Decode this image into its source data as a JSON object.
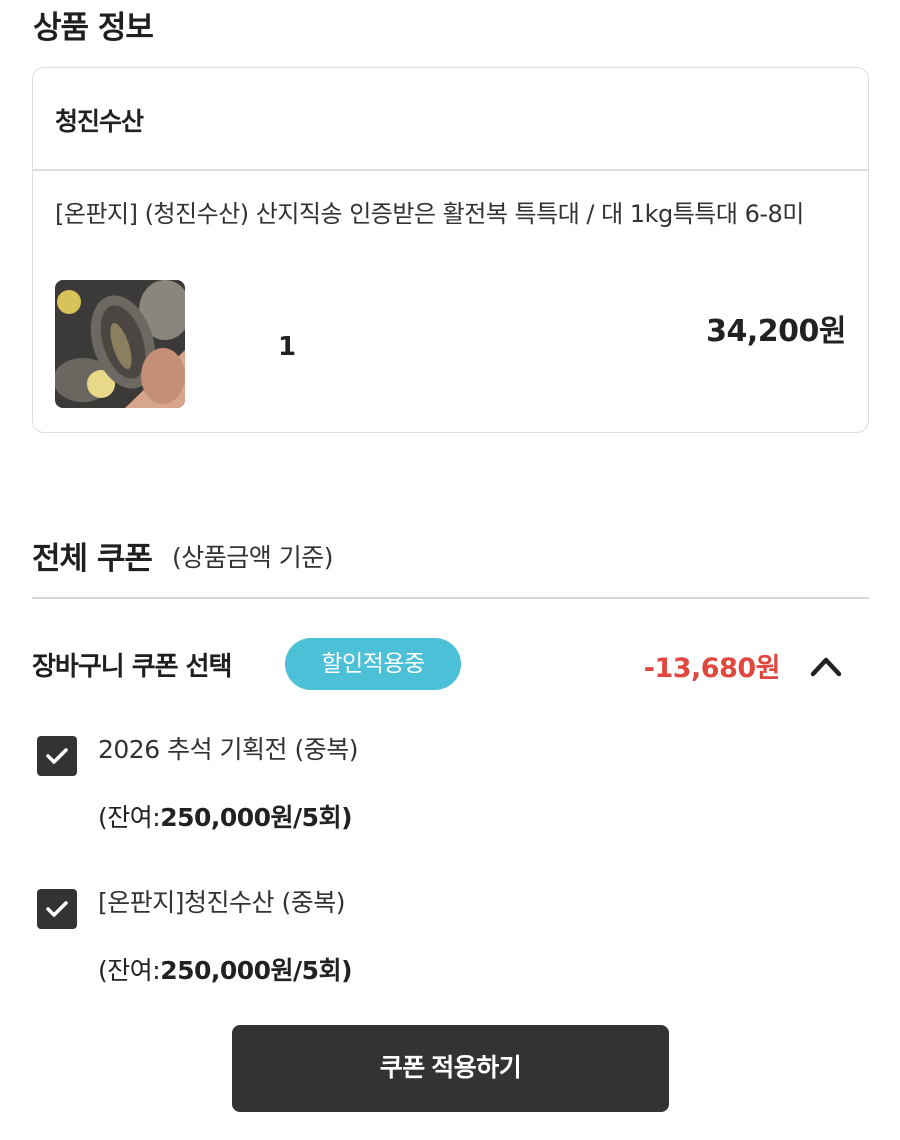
{
  "product_info": {
    "section_title": "상품 정보",
    "seller": "청진수산",
    "product_name": "[온판지] (청진수산) 산지직송 인증받은 활전복 특특대 / 대 1kg특특대 6-8미",
    "quantity": "1",
    "price": "34,200원"
  },
  "coupons": {
    "section_title": "전체 쿠폰",
    "section_subtitle": "(상품금액 기준)",
    "cart_coupon_label": "장바구니 쿠폰 선택",
    "badge": "할인적용중",
    "discount": "-13,680원",
    "items": [
      {
        "name": "2026 추석 기획전 (중복)",
        "remain_prefix": "(잔여:",
        "remain_value": "250,000원/5회",
        "remain_suffix": ")",
        "checked": true
      },
      {
        "name": "[온판지]청진수산 (중복)",
        "remain_prefix": "(잔여:",
        "remain_value": "250,000원/5회",
        "remain_suffix": ")",
        "checked": true
      }
    ],
    "apply_button": "쿠폰 적용하기"
  },
  "colors": {
    "accent_badge": "#4cc0d6",
    "discount_red": "#e0473e",
    "dark": "#333333"
  },
  "icons": {
    "collapse": "chevron-up-icon",
    "check": "check-icon"
  }
}
